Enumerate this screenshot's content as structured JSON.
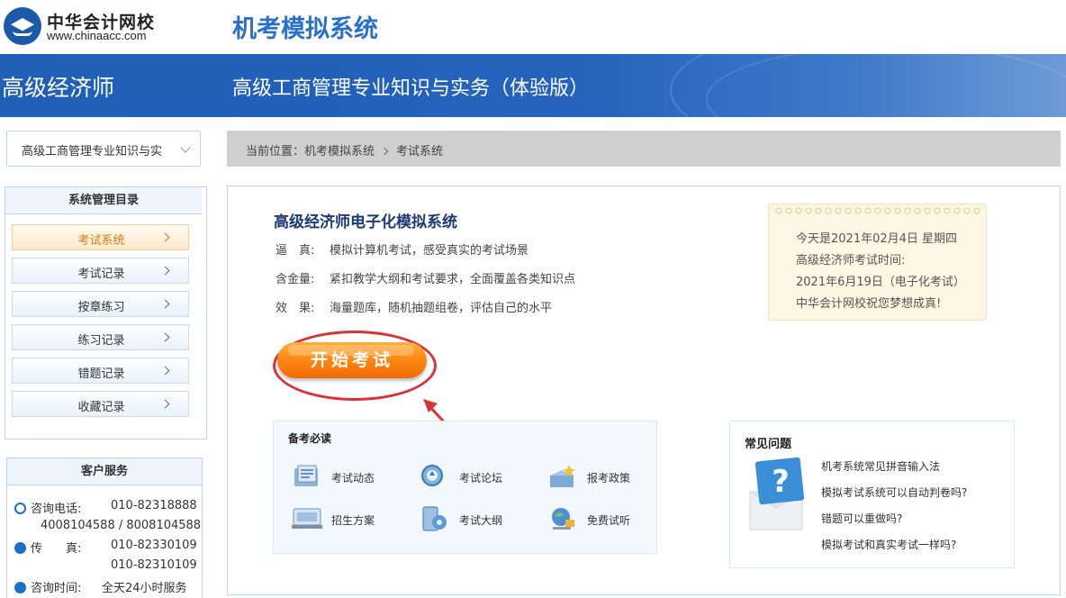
{
  "header": {
    "logo_cn": "中华会计网校",
    "logo_en": "www.chinaacc.com",
    "system_title": "机考模拟系统"
  },
  "banner": {
    "level": "高级经济师",
    "subject": "高级工商管理专业知识与实务（体验版）"
  },
  "subject_select": {
    "value": "高级工商管理专业知识与实"
  },
  "breadcrumb": {
    "prefix": "当前位置：",
    "items": [
      "机考模拟系统",
      "考试系统"
    ]
  },
  "menu": {
    "title": "系统管理目录",
    "items": [
      {
        "label": "考试系统",
        "active": true
      },
      {
        "label": "考试记录",
        "active": false
      },
      {
        "label": "按章练习",
        "active": false
      },
      {
        "label": "练习记录",
        "active": false
      },
      {
        "label": "错题记录",
        "active": false
      },
      {
        "label": "收藏记录",
        "active": false
      }
    ]
  },
  "customer_service": {
    "title": "客户服务",
    "phone_label": "咨询电话:",
    "phone_1": "010-82318888",
    "phone_2": "4008104588 / 8008104588",
    "fax_label": "传　　真:",
    "fax_1": "010-82330109",
    "fax_2": "010-82310109",
    "hours_label": "咨询时间:",
    "hours": "全天24小时服务"
  },
  "intro": {
    "title": "高级经济师电子化模拟系统",
    "lines": [
      {
        "key": "逼　真:",
        "value": "模拟计算机考试，感受真实的考试场景"
      },
      {
        "key": "含金量:",
        "value": "紧扣教学大纲和考试要求，全面覆盖各类知识点"
      },
      {
        "key": "效　果:",
        "value": "海量题库，随机抽题组卷，评估自己的水平"
      }
    ]
  },
  "date_note": {
    "lines": [
      "今天是2021年02月4日 星期四",
      "高级经济师考试时间:",
      "2021年6月19日（电子化考试）",
      "中华会计网校祝您梦想成真!"
    ]
  },
  "start_button": {
    "label": "开始考试"
  },
  "reading": {
    "title": "备考必读",
    "items": [
      {
        "label": "考试动态",
        "icon": "news-icon"
      },
      {
        "label": "考试论坛",
        "icon": "forum-icon"
      },
      {
        "label": "报考政策",
        "icon": "policy-icon"
      },
      {
        "label": "招生方案",
        "icon": "enrollment-icon"
      },
      {
        "label": "考试大纲",
        "icon": "syllabus-icon"
      },
      {
        "label": "免费试听",
        "icon": "free-trial-icon"
      }
    ]
  },
  "faq": {
    "title": "常见问题",
    "items": [
      "机考系统常见拼音输入法",
      "模拟考试系统可以自动判卷吗?",
      "错题可以重做吗?",
      "模拟考试和真实考试一样吗?"
    ]
  },
  "colors": {
    "brand_blue": "#1f5fb6",
    "title_blue": "#2a6fc9",
    "active_orange": "#e07a10",
    "button_orange": "#ff8a14",
    "annotation_red": "#d9333a"
  }
}
